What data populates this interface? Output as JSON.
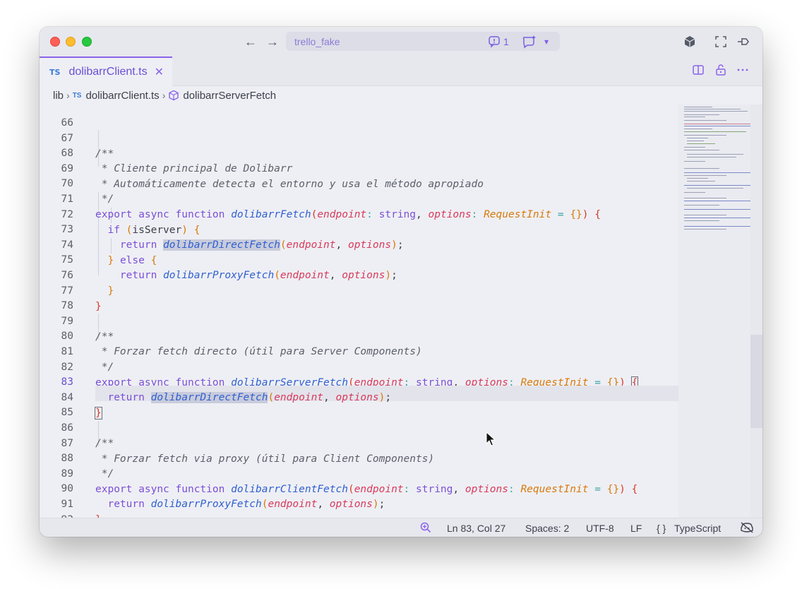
{
  "titlebar": {
    "back_icon": "arrow-left-icon",
    "forward_icon": "arrow-right-icon",
    "command_center_text": "trello_fake",
    "issues_count": "1",
    "icons": [
      "cube-icon",
      "fullscreen-icon",
      "pin-icon"
    ]
  },
  "tab": {
    "badge": "TS",
    "label": "dolibarrClient.ts",
    "close": "✕"
  },
  "breadcrumb": {
    "folder": "lib",
    "file_badge": "TS",
    "file": "dolibarrClient.ts",
    "symbol": "dolibarrServerFetch"
  },
  "editor": {
    "line_numbers": [
      "66",
      "67",
      "68",
      "69",
      "70",
      "71",
      "72",
      "73",
      "74",
      "75",
      "76",
      "77",
      "78",
      "79",
      "80",
      "81",
      "82",
      "83",
      "84",
      "85",
      "86",
      "87",
      "88",
      "89",
      "90",
      "91",
      "92"
    ],
    "active_line": "83",
    "comments": {
      "c67": "/**",
      "c68": " * Cliente principal de Dolibarr",
      "c69": " * Automáticamente detecta el entorno y usa el método apropiado",
      "c70": " */",
      "c79": "/**",
      "c80": " * Forzar fetch directo (útil para Server Components)",
      "c81": " */",
      "c86": "/**",
      "c87": " * Forzar fetch via proxy (útil para Client Components)",
      "c88": " */"
    },
    "keywords": {
      "export": "export",
      "async": "async",
      "function": "function",
      "if": "if",
      "return": "return",
      "else": "else",
      "string": "string"
    },
    "functions": {
      "dolibarrFetch": "dolibarrFetch",
      "dolibarrDirectFetch": "dolibarrDirectFetch",
      "dolibarrProxyFetch": "dolibarrProxyFetch",
      "dolibarrServerFetch": "dolibarrServerFetch",
      "dolibarrClientFetch": "dolibarrClientFetch"
    },
    "params": {
      "endpoint": "endpoint",
      "options": "options"
    },
    "types": {
      "RequestInit": "RequestInit"
    },
    "vars": {
      "isServer": "isServer"
    }
  },
  "statusbar": {
    "position": "Ln 83, Col 27",
    "spaces": "Spaces: 2",
    "encoding": "UTF-8",
    "eol": "LF",
    "language_icon": "{ }",
    "language": "TypeScript"
  },
  "colors": {
    "accent": "#8a63e8",
    "keyword": "#7b4fd6",
    "function": "#2f5fd0",
    "param": "#d83a5c",
    "type": "#d8790a"
  }
}
